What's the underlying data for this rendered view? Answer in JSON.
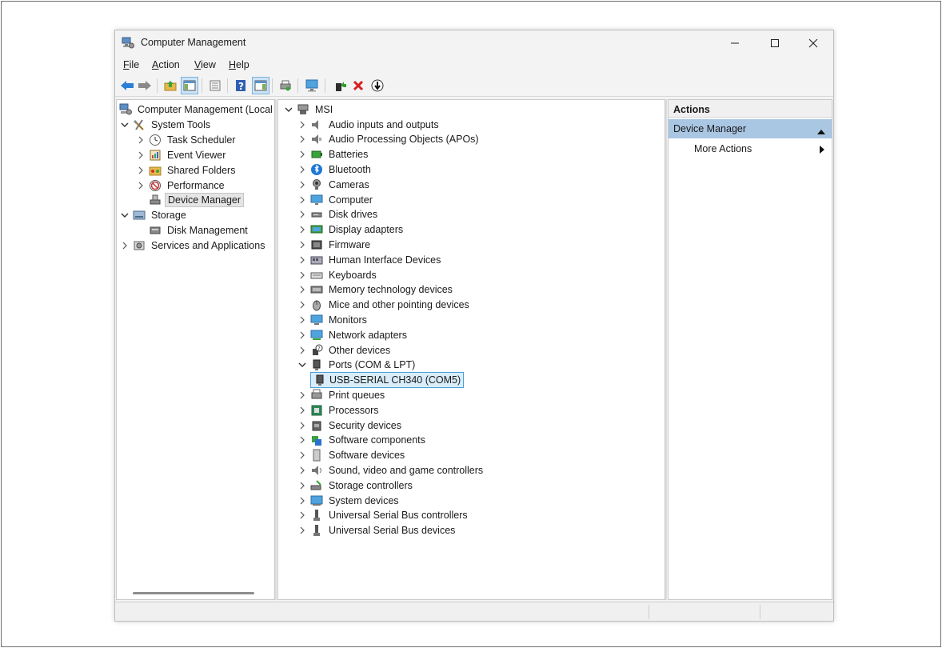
{
  "window": {
    "title": "Computer Management"
  },
  "menubar": [
    {
      "key": "F",
      "rest": "ile"
    },
    {
      "key": "A",
      "rest": "ction"
    },
    {
      "key": "V",
      "rest": "iew"
    },
    {
      "key": "H",
      "rest": "elp"
    }
  ],
  "left_tree": {
    "root": "Computer Management (Local",
    "system_tools": "System Tools",
    "task_scheduler": "Task Scheduler",
    "event_viewer": "Event Viewer",
    "shared_folders": "Shared Folders",
    "performance": "Performance",
    "device_manager": "Device Manager",
    "storage": "Storage",
    "disk_management": "Disk Management",
    "services": "Services and Applications"
  },
  "device_tree": {
    "root": "MSI",
    "categories": [
      "Audio inputs and outputs",
      "Audio Processing Objects (APOs)",
      "Batteries",
      "Bluetooth",
      "Cameras",
      "Computer",
      "Disk drives",
      "Display adapters",
      "Firmware",
      "Human Interface Devices",
      "Keyboards",
      "Memory technology devices",
      "Mice and other pointing devices",
      "Monitors",
      "Network adapters",
      "Other devices",
      "Ports (COM & LPT)",
      "USB-SERIAL CH340 (COM5)",
      "Print queues",
      "Processors",
      "Security devices",
      "Software components",
      "Software devices",
      "Sound, video and game controllers",
      "Storage controllers",
      "System devices",
      "Universal Serial Bus controllers",
      "Universal Serial Bus devices"
    ]
  },
  "actions": {
    "header": "Actions",
    "section": "Device Manager",
    "item": "More Actions"
  },
  "colors": {
    "selection_blue": "#d9ecfa",
    "actions_section": "#a9c6e3"
  }
}
